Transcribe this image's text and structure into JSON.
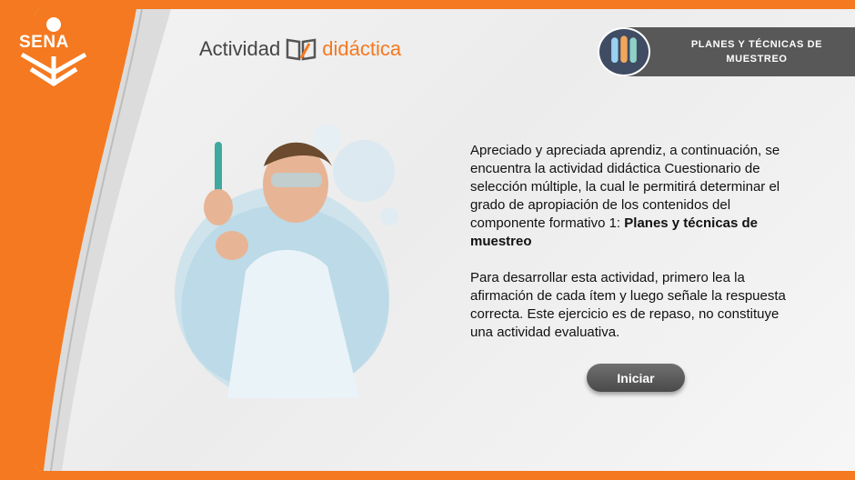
{
  "logo": {
    "text": "SENA"
  },
  "header": {
    "title_part1": "Actividad",
    "title_part2": "didáctica",
    "badge_line1": "PLANES Y TÉCNICAS DE",
    "badge_line2": "MUESTREO"
  },
  "content": {
    "paragraph1_intro": "Apreciado y apreciada aprendiz, a continuación, se encuentra la actividad didáctica Cuestionario de selección múltiple, la cual le permitirá determinar el grado de apropiación de los contenidos del componente formativo 1: ",
    "paragraph1_bold": "Planes y técnicas de muestreo",
    "paragraph2": "Para desarrollar esta actividad, primero lea la afirmación de cada ítem y luego señale la respuesta correcta. Este ejercicio es de repaso, no constituye una actividad evaluativa."
  },
  "actions": {
    "start_label": "Iniciar"
  },
  "colors": {
    "brand_orange": "#f47920",
    "badge_gray": "#585858",
    "button_gray": "#5a5a5a"
  }
}
